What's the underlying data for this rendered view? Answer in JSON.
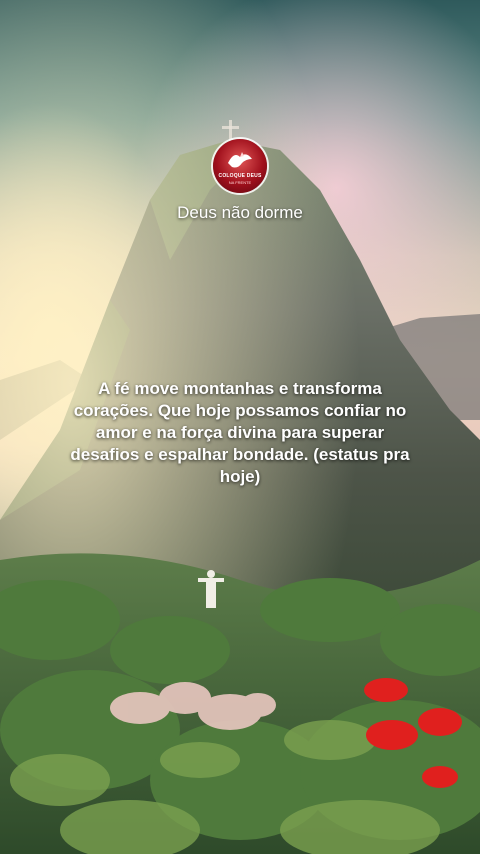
{
  "channel": {
    "avatar_text": "COLOQUE DEUS",
    "avatar_subtext": "NA FRENTE",
    "name": "Deus não dorme"
  },
  "post": {
    "quote": "A fé move montanhas e transforma corações. Que hoje possamos confiar no amor e na força divina para superar desafios e espalhar bondade. (estatus pra hoje)"
  },
  "icons": {
    "avatar": "dove-icon"
  },
  "colors": {
    "caption_text": "#ffffff",
    "avatar_red": "#a0101c",
    "flower_red": "#e0201e"
  }
}
